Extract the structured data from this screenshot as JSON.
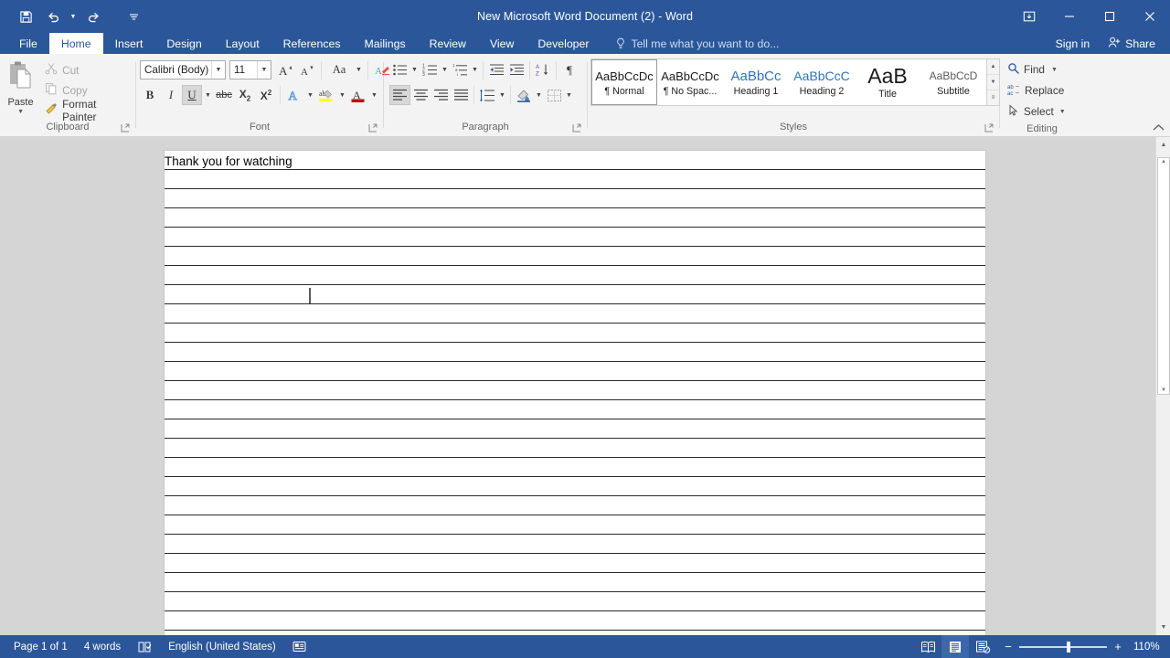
{
  "window": {
    "title": "New Microsoft Word Document (2) - Word",
    "quick_access": [
      {
        "name": "save",
        "icon": "save-icon"
      },
      {
        "name": "undo",
        "icon": "undo-icon",
        "has_caret": true
      },
      {
        "name": "redo",
        "icon": "redo-icon"
      },
      {
        "name": "customize-quick-access-toolbar",
        "icon": "customize-qat-icon"
      }
    ],
    "controls": [
      {
        "name": "ribbon-display-options",
        "icon": "ribbon-options-icon"
      },
      {
        "name": "minimize",
        "icon": "minimize-icon"
      },
      {
        "name": "restore",
        "icon": "restore-icon"
      },
      {
        "name": "close",
        "icon": "close-icon"
      }
    ],
    "accent_color": "#2b579a"
  },
  "tabs": [
    {
      "label": "File",
      "active": false
    },
    {
      "label": "Home",
      "active": true
    },
    {
      "label": "Insert",
      "active": false
    },
    {
      "label": "Design",
      "active": false
    },
    {
      "label": "Layout",
      "active": false
    },
    {
      "label": "References",
      "active": false
    },
    {
      "label": "Mailings",
      "active": false
    },
    {
      "label": "Review",
      "active": false
    },
    {
      "label": "View",
      "active": false
    },
    {
      "label": "Developer",
      "active": false
    }
  ],
  "tell_me": {
    "placeholder": "Tell me what you want to do...",
    "icon": "lightbulb-icon"
  },
  "account": {
    "sign_in_label": "Sign in",
    "share_label": "Share",
    "share_icon": "share-person-icon"
  },
  "ribbon": {
    "clipboard": {
      "label": "Clipboard",
      "paste": {
        "label": "Paste",
        "icon": "paste-clipboard-icon"
      },
      "items": [
        {
          "label": "Cut",
          "icon": "scissors-icon",
          "enabled": false
        },
        {
          "label": "Copy",
          "icon": "copy-icon",
          "enabled": false
        },
        {
          "label": "Format Painter",
          "icon": "format-painter-icon",
          "enabled": true
        }
      ]
    },
    "font": {
      "label": "Font",
      "font_name": "Calibri (Body)",
      "font_size": "11",
      "row1": [
        {
          "name": "grow-font",
          "glyph": "A",
          "sup": "▲"
        },
        {
          "name": "shrink-font",
          "glyph": "A",
          "sup": "▼"
        },
        {
          "name": "change-case",
          "glyph": "Aa",
          "caret": true
        },
        {
          "name": "clear-formatting",
          "glyph": "clear-format-icon"
        }
      ],
      "row2": [
        {
          "name": "bold",
          "glyph": "B"
        },
        {
          "name": "italic",
          "glyph": "I"
        },
        {
          "name": "underline",
          "glyph": "U",
          "active": true,
          "caret": true
        },
        {
          "name": "strikethrough",
          "glyph": "abc"
        },
        {
          "name": "subscript",
          "glyph": "X₂"
        },
        {
          "name": "superscript",
          "glyph": "X²"
        },
        {
          "name": "text-effects",
          "glyph": "A",
          "caret": true
        },
        {
          "name": "text-highlight-color",
          "glyph": "ab",
          "caret": true,
          "color": "#ffff00"
        },
        {
          "name": "font-color",
          "glyph": "A",
          "caret": true,
          "color": "#c00000"
        }
      ]
    },
    "paragraph": {
      "label": "Paragraph",
      "row1": [
        {
          "name": "bullets",
          "caret": true
        },
        {
          "name": "numbering",
          "caret": true
        },
        {
          "name": "multilevel-list",
          "caret": true
        },
        {
          "name": "decrease-indent"
        },
        {
          "name": "increase-indent"
        },
        {
          "name": "sort"
        },
        {
          "name": "show-formatting-marks",
          "glyph": "¶"
        }
      ],
      "row2": [
        {
          "name": "align-left",
          "active": true
        },
        {
          "name": "align-center"
        },
        {
          "name": "align-right"
        },
        {
          "name": "justify"
        },
        {
          "name": "line-and-paragraph-spacing",
          "caret": true
        },
        {
          "name": "shading",
          "caret": true
        },
        {
          "name": "borders",
          "caret": true
        }
      ]
    },
    "styles": {
      "label": "Styles",
      "items": [
        {
          "preview": "AaBbCcDc",
          "name": "¶ Normal",
          "kind": "normal",
          "selected": true
        },
        {
          "preview": "AaBbCcDc",
          "name": "¶ No Spac...",
          "kind": "normal",
          "selected": false
        },
        {
          "preview": "AaBbCc",
          "name": "Heading 1",
          "kind": "h1",
          "selected": false
        },
        {
          "preview": "AaBbCcC",
          "name": "Heading 2",
          "kind": "h2",
          "selected": false
        },
        {
          "preview": "AaB",
          "name": "Title",
          "kind": "title",
          "selected": false
        },
        {
          "preview": "AaBbCcD",
          "name": "Subtitle",
          "kind": "sub",
          "selected": false
        }
      ],
      "scroll": [
        "▲",
        "▼",
        "≡"
      ]
    },
    "editing": {
      "label": "Editing",
      "items": [
        {
          "label": "Find",
          "icon": "magnifier-icon",
          "caret": true
        },
        {
          "label": "Replace",
          "icon": "replace-icon",
          "caret": false
        },
        {
          "label": "Select",
          "icon": "cursor-select-icon",
          "caret": true
        }
      ]
    },
    "collapse_icon": "chevron-up-icon"
  },
  "document": {
    "lines": [
      {
        "text": "Thank you for watching",
        "caret": false
      },
      {
        "text": "",
        "caret": false
      },
      {
        "text": "",
        "caret": false
      },
      {
        "text": "",
        "caret": false
      },
      {
        "text": "",
        "caret": false
      },
      {
        "text": "",
        "caret": false
      },
      {
        "text": "",
        "caret": false
      },
      {
        "text": "",
        "caret": true
      },
      {
        "text": "",
        "caret": false
      },
      {
        "text": "",
        "caret": false
      },
      {
        "text": "",
        "caret": false
      },
      {
        "text": "",
        "caret": false
      },
      {
        "text": "",
        "caret": false
      },
      {
        "text": "",
        "caret": false
      },
      {
        "text": "",
        "caret": false
      },
      {
        "text": "",
        "caret": false
      },
      {
        "text": "",
        "caret": false
      },
      {
        "text": "",
        "caret": false
      },
      {
        "text": "",
        "caret": false
      },
      {
        "text": "",
        "caret": false
      },
      {
        "text": "",
        "caret": false
      },
      {
        "text": "",
        "caret": false
      },
      {
        "text": "",
        "caret": false
      },
      {
        "text": "",
        "caret": false
      },
      {
        "text": "",
        "caret": false
      },
      {
        "text": "",
        "caret": false
      }
    ]
  },
  "scrollbar": {
    "up_arrow": "▲",
    "down_arrow": "▼"
  },
  "status_bar": {
    "page": "Page 1 of 1",
    "words": "4 words",
    "proofing_icon": "proofing-errors-icon",
    "language": "English (United States)",
    "macro_icon": "macro-record-icon",
    "views": [
      {
        "name": "read-mode",
        "icon": "read-mode-icon",
        "active": false
      },
      {
        "name": "print-layout",
        "icon": "print-layout-icon",
        "active": true
      },
      {
        "name": "web-layout",
        "icon": "web-layout-icon",
        "active": false
      }
    ],
    "zoom_out": "−",
    "zoom_in": "+",
    "zoom_level": "110%"
  }
}
